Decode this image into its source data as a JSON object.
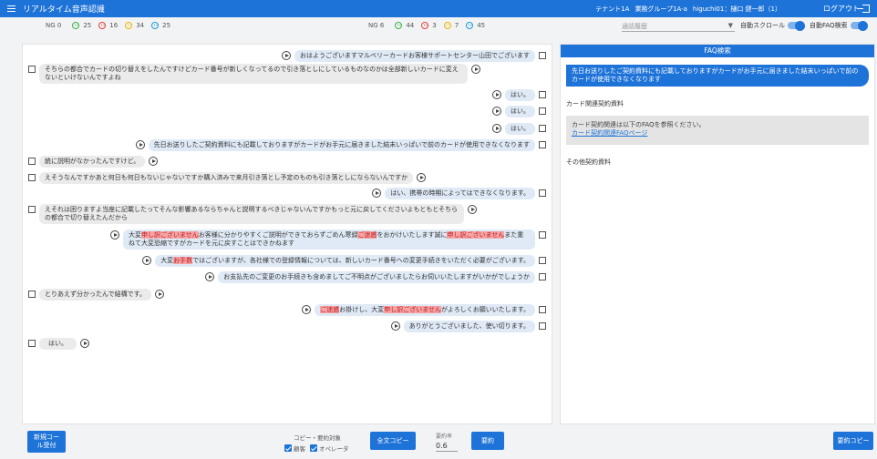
{
  "header": {
    "title": "リアルタイム音声認識",
    "tenant": "テナント1A",
    "group": "業務グループ1A-a",
    "user": "higuchi01：樋口 健一郎（1）",
    "logout": "ログアウト"
  },
  "stats_customer": {
    "ng_label": "NG 0",
    "items": [
      {
        "icon": "smile-face-icon",
        "value": "25"
      },
      {
        "icon": "angry-face-icon",
        "value": "16"
      },
      {
        "icon": "neutral-face-icon",
        "value": "34"
      },
      {
        "icon": "calm-face-icon",
        "value": "25"
      }
    ]
  },
  "stats_operator": {
    "ng_label": "NG 6",
    "items": [
      {
        "icon": "smile-face-icon",
        "value": "44"
      },
      {
        "icon": "angry-face-icon",
        "value": "3"
      },
      {
        "icon": "neutral-face-icon",
        "value": "7"
      },
      {
        "icon": "calm-face-icon",
        "value": "45"
      }
    ]
  },
  "controls": {
    "history_placeholder": "通話履歴",
    "auto_scroll": "自動スクロール",
    "auto_faq": "自動FAQ検索"
  },
  "messages": [
    {
      "speaker": "operator",
      "text": "おはようございますマルベリーカードお客様サポートセンター山田でございます"
    },
    {
      "speaker": "customer",
      "text": "そちらの都合でカードの切り替えをしたんですけどカード番号が新しくなってるので引き落としにしているものなのかは全部新しいカードに変えないといけないんですよね"
    },
    {
      "speaker": "operator",
      "text": "はい。"
    },
    {
      "speaker": "operator",
      "text": "はい。"
    },
    {
      "speaker": "operator",
      "text": "はい。"
    },
    {
      "speaker": "operator",
      "text": "先日お送りしたご契約資料にも記載しておりますがカードがお手元に届きました結末いっぱいで前のカードが使用できなくなります"
    },
    {
      "speaker": "customer",
      "text": "統に説明がなかったんですけど。"
    },
    {
      "speaker": "customer",
      "text": "えそうなんですかあと何日も何日もないじゃないですか購入済みで来月引き落とし予定のものも引き落としにならないんですか"
    },
    {
      "speaker": "operator",
      "text": "はい、携帯の時期によってはできなくなります。"
    },
    {
      "speaker": "customer",
      "text": "えそれは困りますよ当座に記載したってそんな影響あるならちゃんと説明するべきじゃないんですかもっと元に戻してくださいよもともとそちらの都合で切り替えたんだから"
    },
    {
      "speaker": "operator",
      "segments": [
        {
          "t": "大変",
          "ng": false
        },
        {
          "t": "申し訳ございません",
          "ng": true
        },
        {
          "t": "お客様に分かりやすくご説明ができておらずごめん寒録",
          "ng": false
        },
        {
          "t": "ご迷惑",
          "ng": true
        },
        {
          "t": "をおかけいたします誠に",
          "ng": false
        },
        {
          "t": "申し訳ございません",
          "ng": true
        },
        {
          "t": "また重ねて大変恐縮ですがカードを元に戻すことはできかねます",
          "ng": false
        }
      ]
    },
    {
      "speaker": "operator",
      "segments": [
        {
          "t": "大変",
          "ng": false
        },
        {
          "t": "お手数",
          "ng": true
        },
        {
          "t": "ではございますが、各社様での登録情報については、新しいカード番号への変更手続きをいただく必要がございます。",
          "ng": false
        }
      ]
    },
    {
      "speaker": "operator",
      "text": "お支払先のご変更のお手続きも含めましてご不明点がございましたらお伺いいたしますがいかがでしょうか"
    },
    {
      "speaker": "customer",
      "text": "とりあえず分かったんで結構です。"
    },
    {
      "speaker": "operator",
      "segments": [
        {
          "t": "ご迷惑",
          "ng": true
        },
        {
          "t": "お掛けし、大変",
          "ng": false
        },
        {
          "t": "申し訳ございません",
          "ng": true
        },
        {
          "t": "がよろしくお願いいたします。",
          "ng": false
        }
      ]
    },
    {
      "speaker": "operator",
      "text": "ありがとうございました、使い切ります。"
    },
    {
      "speaker": "customer",
      "text": "はい。"
    }
  ],
  "faq": {
    "title": "FAQ検索",
    "query": "先日お送りしたご契約資料にも記載しておりますがカードがお手元に届きました結末いっぱいで前のカードが使用できなくなります",
    "section1": "カード関連契約資料",
    "card_text": "カード契約関連は以下のFAQを参照ください。",
    "card_link": "カード契約関連FAQページ",
    "section2": "その他契約資料"
  },
  "footer": {
    "new_call": "新規コール受付",
    "copy_target_title": "コピー・要約対象",
    "copy_customer": "顧客",
    "copy_operator": "オペレータ",
    "full_copy": "全文コピー",
    "ratio_label": "要約率",
    "ratio_value": "0.6",
    "summarize": "要約",
    "summary_copy": "要約コピー"
  },
  "colors": {
    "accent": "#1e73d8",
    "operator_bubble": "#dfeaf6",
    "customer_bubble": "#ebebeb",
    "ng_highlight": "#f5a3a3"
  }
}
